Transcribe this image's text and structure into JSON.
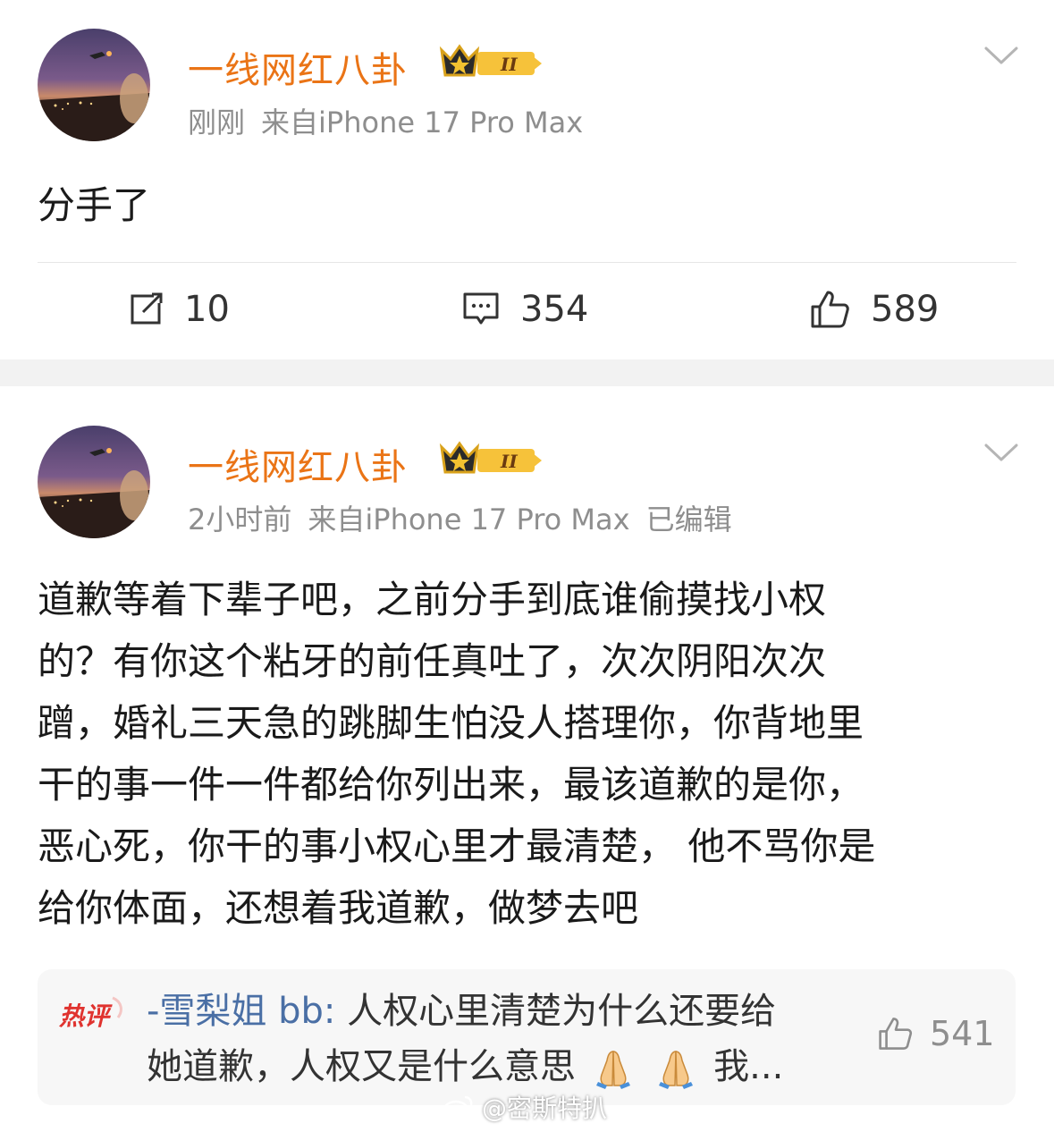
{
  "post1": {
    "username": "一线网红八卦",
    "vip_level": "II",
    "time": "刚刚",
    "source": "来自iPhone 17 Pro Max",
    "text_lines": [
      "分手了"
    ],
    "repost_count": "10",
    "comment_count": "354",
    "like_count": "589"
  },
  "post2": {
    "username": "一线网红八卦",
    "vip_level": "II",
    "time": "2小时前",
    "source": "来自iPhone 17 Pro Max",
    "edited": "已编辑",
    "text_lines": [
      "道歉等着下辈子吧，之前分手到底谁偷摸找小权",
      "的？有你这个粘牙的前任真吐了，次次阴阳次次",
      "蹭，婚礼三天急的跳脚生怕没人搭理你，你背地里",
      "干的事一件一件都给你列出来，最该道歉的是你，",
      "恶心死，你干的事小权心里才最清楚， 他不骂你是",
      "给你体面，还想着我道歉，做梦去吧"
    ],
    "hot_comment": {
      "badge": "热评",
      "user": "-雪梨姐 bb:",
      "text_line1": " 人权心里清楚为什么还要给",
      "text_line2": "她道歉，人权又是什么意思",
      "text_tail": "我...",
      "like_count": "541"
    }
  },
  "watermark": "@密斯特扒",
  "colors": {
    "username": "#ea7416",
    "meta": "#8e8e8e",
    "hot_user": "#4a6fa5",
    "hot_badge": "#e0332f",
    "gap": "#f2f2f2"
  },
  "icons": [
    "avatar-image",
    "vip-crown-icon",
    "chevron-down-icon",
    "repost-icon",
    "comment-icon",
    "like-icon",
    "pray-emoji",
    "weibo-logo-icon"
  ]
}
